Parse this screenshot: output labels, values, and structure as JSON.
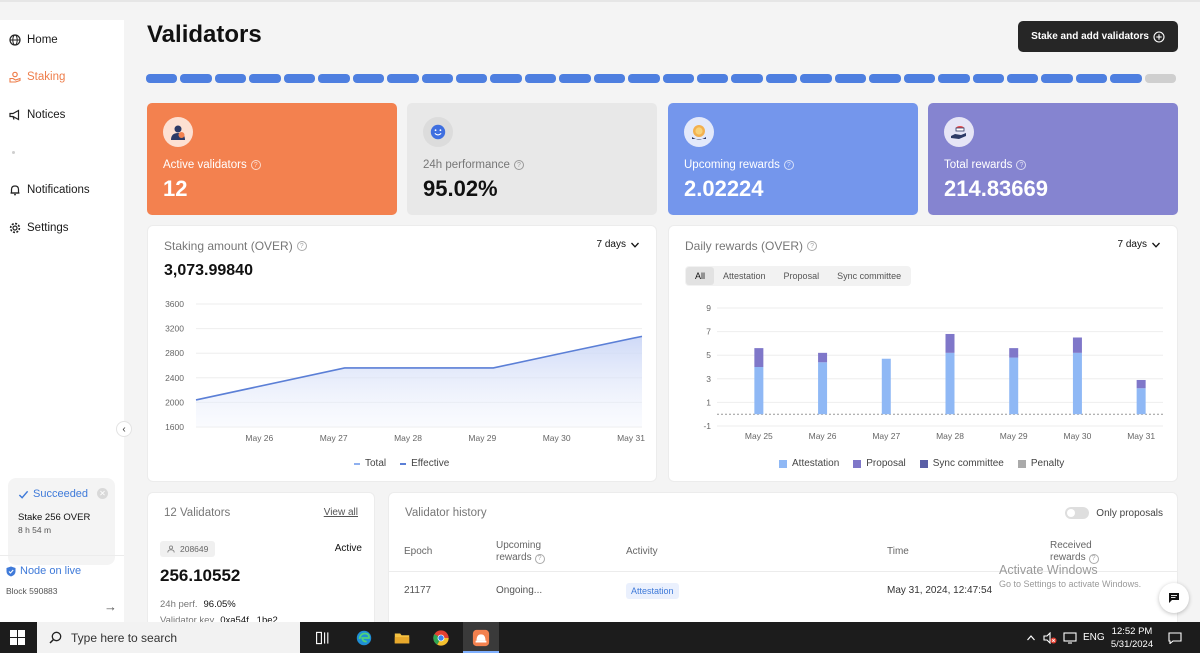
{
  "sidebar": {
    "items": [
      {
        "label": "Home",
        "icon": "globe-icon",
        "active": false
      },
      {
        "label": "Staking",
        "icon": "staking-icon",
        "active": true
      },
      {
        "label": "Notices",
        "icon": "megaphone-icon",
        "active": false
      },
      {
        "label": "Notifications",
        "icon": "bell-icon",
        "active": false
      },
      {
        "label": "Settings",
        "icon": "gear-icon",
        "active": false
      }
    ],
    "toast": {
      "status": "Succeeded",
      "message": "Stake 256 OVER",
      "time": "8 h 54 m"
    },
    "node": {
      "status": "Node on live",
      "block": "Block 590883"
    },
    "accent": "#ee7d4a"
  },
  "header": {
    "title": "Validators",
    "stake_button": "Stake and add validators",
    "progress": {
      "segments_total": 30,
      "segments_filled": 29,
      "fill_color": "#4e7fe0"
    }
  },
  "stats": [
    {
      "label": "Active validators",
      "value": "12",
      "bg": "#f3814f",
      "fg": "#ffffff"
    },
    {
      "label": "24h performance",
      "value": "95.02%",
      "bg": "#e8e8e8",
      "fg": "#111111"
    },
    {
      "label": "Upcoming rewards",
      "value": "2.02224",
      "bg": "#7496ec",
      "fg": "#ffffff"
    },
    {
      "label": "Total rewards",
      "value": "214.83669",
      "bg": "#8584d0",
      "fg": "#ffffff"
    }
  ],
  "staking_card": {
    "title": "Staking amount (OVER)",
    "period": "7 days",
    "amount": "3,073.99840",
    "legend": [
      "Total",
      "Effective"
    ]
  },
  "rewards_card": {
    "title": "Daily rewards (OVER)",
    "period": "7 days",
    "tabs": [
      "All",
      "Attestation",
      "Proposal",
      "Sync committee"
    ],
    "active_tab": "All",
    "legend": [
      "Attestation",
      "Proposal",
      "Sync committee",
      "Penalty"
    ]
  },
  "chart_data": [
    {
      "type": "area",
      "x": [
        "May 26",
        "May 27",
        "May 28",
        "May 29",
        "May 30",
        "May 31"
      ],
      "series": [
        {
          "name": "Effective",
          "values": [
            2040,
            2560,
            2560,
            2560,
            2820,
            3074
          ],
          "color": "#5b7fd6"
        }
      ],
      "yticks": [
        "3600",
        "3200",
        "2800",
        "2400",
        "2000",
        "1600"
      ],
      "ylim": [
        1600,
        3600
      ],
      "grid": true,
      "legend_placement": "bottom"
    },
    {
      "type": "bar",
      "categories": [
        "May 25",
        "May 26",
        "May 27",
        "May 28",
        "May 29",
        "May 30",
        "May 31"
      ],
      "series": [
        {
          "name": "Attestation",
          "values": [
            4.0,
            4.4,
            4.7,
            5.2,
            4.8,
            5.2,
            2.2
          ],
          "color": "#8fb8f5"
        },
        {
          "name": "Proposal",
          "values": [
            1.6,
            0.8,
            0,
            1.6,
            0.8,
            1.3,
            0.7
          ],
          "color": "#7f77c9"
        },
        {
          "name": "Sync committee",
          "values": [
            0,
            0,
            0,
            0,
            0,
            0,
            0
          ],
          "color": "#5a5fa6"
        },
        {
          "name": "Penalty",
          "values": [
            0,
            0,
            0,
            0,
            0,
            0,
            0
          ],
          "color": "#aaaaaa"
        }
      ],
      "yticks": [
        "9",
        "7",
        "5",
        "3",
        "1",
        "-1"
      ],
      "ylim": [
        -1,
        9
      ],
      "grid": true,
      "stacked": true,
      "legend_placement": "bottom"
    }
  ],
  "validators": {
    "count_label": "12 Validators",
    "view_all": "View all",
    "item": {
      "id": "208649",
      "status": "Active",
      "balance": "256.10552",
      "perf_label": "24h perf.",
      "perf": "96.05%",
      "key_label": "Validator key",
      "key": "0xa54f...1be2"
    }
  },
  "history": {
    "title": "Validator history",
    "toggle_label": "Only proposals",
    "columns": [
      "Epoch",
      "Upcoming rewards",
      "Activity",
      "Time",
      "Received rewards"
    ],
    "rows": [
      {
        "epoch": "21177",
        "upcoming": "Ongoing...",
        "activity": "Attestation",
        "time": "May 31, 2024, 12:47:54"
      }
    ]
  },
  "watermark": {
    "line1": "Activate Windows",
    "line2": "Go to Settings to activate Windows."
  },
  "taskbar": {
    "search_placeholder": "Type here to search",
    "lang": "ENG",
    "time": "12:52 PM",
    "date": "5/31/2024"
  }
}
